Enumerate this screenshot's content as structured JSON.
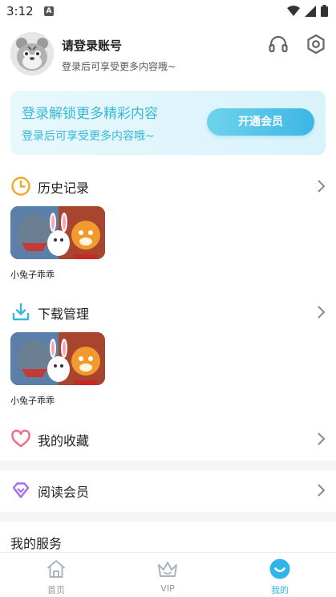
{
  "statusbar": {
    "time": "3:12",
    "a_badge": "A"
  },
  "profile": {
    "username": "请登录账号",
    "subtitle": "登录后可享受更多内容哦~"
  },
  "vip_banner": {
    "title": "登录解锁更多精彩内容",
    "subtitle": "登录后可享受更多内容哦~",
    "button": "开通会员"
  },
  "history": {
    "title": "历史记录",
    "items": [
      {
        "label": "小兔子乖乖"
      }
    ]
  },
  "downloads": {
    "title": "下载管理",
    "items": [
      {
        "label": "小兔子乖乖"
      }
    ]
  },
  "favorites": {
    "title": "我的收藏"
  },
  "reading_vip": {
    "title": "阅读会员"
  },
  "services": {
    "title": "我的服务"
  },
  "tabbar": {
    "tabs": [
      {
        "label": "首页",
        "icon": "home-icon"
      },
      {
        "label": "VIP",
        "icon": "crown-icon"
      },
      {
        "label": "我的",
        "icon": "smile-icon",
        "active": true
      }
    ]
  },
  "colors": {
    "accent": "#35b8d9",
    "tab_active": "#2fb5e8",
    "history_icon": "#f5a623",
    "favorite_icon": "#f06a8a",
    "reading_icon": "#a46ef0"
  }
}
